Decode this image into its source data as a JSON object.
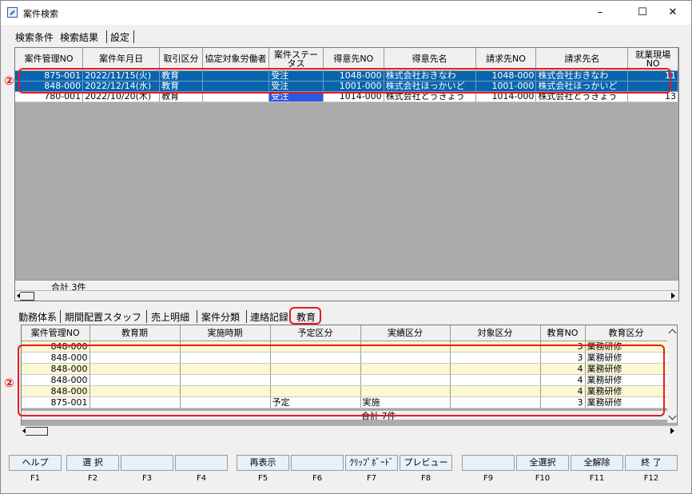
{
  "window": {
    "title": "案件検索",
    "min_glyph": "–",
    "max_glyph": "☐",
    "close_glyph": "✕"
  },
  "top_tabs": [
    "検索条件",
    "検索結果",
    "設定"
  ],
  "grid1": {
    "columns": [
      "案件管理NO",
      "案件年月日",
      "取引区分",
      "協定対象労働者",
      "案件ステータス",
      "得意先NO",
      "得意先名",
      "請求先NO",
      "請求先名",
      "就業現場NO"
    ],
    "rows": [
      {
        "no": "875-001",
        "date": "2022/11/15(火)",
        "kubun": "教育",
        "kyotei": "",
        "status": "受注",
        "tno": "1048-000",
        "tname": "株式会社おきなわ",
        "sno": "1048-000",
        "sname": "株式会社おきなわ",
        "genba": "11",
        "selected": true
      },
      {
        "no": "848-000",
        "date": "2022/12/14(水)",
        "kubun": "教育",
        "kyotei": "",
        "status": "受注",
        "tno": "1001-000",
        "tname": "株式会社ほっかいど",
        "sno": "1001-000",
        "sname": "株式会社ほっかいど",
        "genba": "",
        "selected": true
      },
      {
        "no": "780-001",
        "date": "2022/10/20(木)",
        "kubun": "教育",
        "kyotei": "",
        "status": "受注",
        "tno": "1014-000",
        "tname": "株式会社とうきょう",
        "sno": "1014-000",
        "sname": "株式会社とうきょう",
        "genba": "13",
        "selected": false
      }
    ],
    "total_label": "合計 3件"
  },
  "annotation_marker": "②",
  "sub_tabs": [
    "勤務体系",
    "期間配置スタッフ",
    "売上明細",
    "案件分類",
    "連絡記録",
    "教育"
  ],
  "grid2": {
    "columns": [
      "案件管理NO",
      "教育期",
      "実施時期",
      "予定区分",
      "実績区分",
      "対象区分",
      "教育NO",
      "教育区分"
    ],
    "rows": [
      {
        "no": "848-000",
        "ki": "",
        "jiki": "",
        "yotei": "",
        "jisseki": "",
        "taisho": "",
        "kno": "3",
        "kubun": "業務研修"
      },
      {
        "no": "848-000",
        "ki": "",
        "jiki": "",
        "yotei": "",
        "jisseki": "",
        "taisho": "",
        "kno": "3",
        "kubun": "業務研修"
      },
      {
        "no": "848-000",
        "ki": "",
        "jiki": "",
        "yotei": "",
        "jisseki": "",
        "taisho": "",
        "kno": "4",
        "kubun": "業務研修"
      },
      {
        "no": "848-000",
        "ki": "",
        "jiki": "",
        "yotei": "",
        "jisseki": "",
        "taisho": "",
        "kno": "4",
        "kubun": "業務研修"
      },
      {
        "no": "848-000",
        "ki": "",
        "jiki": "",
        "yotei": "",
        "jisseki": "",
        "taisho": "",
        "kno": "4",
        "kubun": "業務研修"
      },
      {
        "no": "875-001",
        "ki": "",
        "jiki": "",
        "yotei": "予定",
        "jisseki": "実施",
        "taisho": "",
        "kno": "3",
        "kubun": "業務研修"
      }
    ],
    "total_label": "合計 7件"
  },
  "fkeys": [
    {
      "label": "ヘルプ",
      "key": "F1"
    },
    {
      "label": "選 択",
      "key": "F2"
    },
    {
      "label": "",
      "key": "F3"
    },
    {
      "label": "",
      "key": "F4"
    },
    {
      "label": "再表示",
      "key": "F5"
    },
    {
      "label": "",
      "key": "F6"
    },
    {
      "label": "ｸﾘｯﾌﾟﾎﾞｰﾄﾞ",
      "key": "F7"
    },
    {
      "label": "プレビュー",
      "key": "F8"
    },
    {
      "label": "",
      "key": "F9"
    },
    {
      "label": "全選択",
      "key": "F10"
    },
    {
      "label": "全解除",
      "key": "F11"
    },
    {
      "label": "終 了",
      "key": "F12"
    }
  ],
  "colors": {
    "selection": "#0a64ad",
    "annotation": "#e41c1c",
    "row_yellow": "#fcf8d2",
    "status_cell": "#2d57e6"
  }
}
